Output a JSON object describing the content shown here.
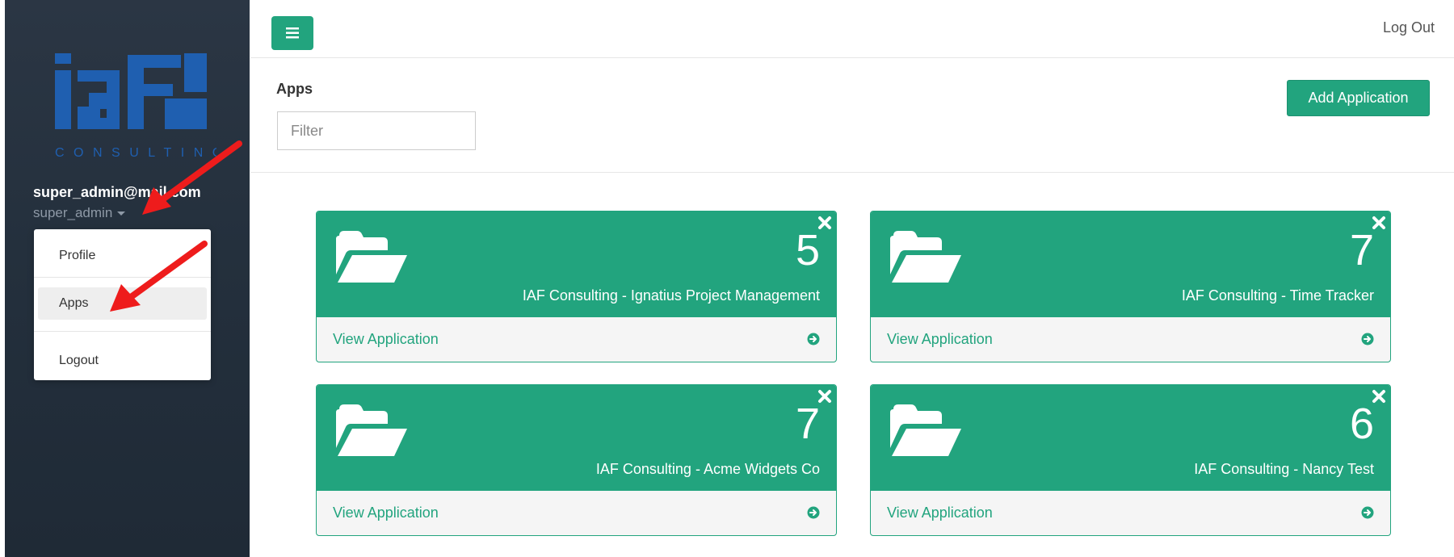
{
  "sidebar": {
    "logo_text": "iaF",
    "logo_subtext": "CONSULTING",
    "user_email": "super_admin@mail.com",
    "user_role": "super_admin",
    "menu": {
      "profile": "Profile",
      "apps": "Apps",
      "logout": "Logout"
    }
  },
  "topbar": {
    "menu_icon": "hamburger-icon",
    "logout_label": "Log Out"
  },
  "apps_header": {
    "title": "Apps",
    "filter_placeholder": "Filter",
    "add_label": "Add Application"
  },
  "cards": [
    {
      "count": "5",
      "name": "IAF Consulting - Ignatius Project Management",
      "view_label": "View Application"
    },
    {
      "count": "7",
      "name": "IAF Consulting - Time Tracker",
      "view_label": "View Application"
    },
    {
      "count": "7",
      "name": "IAF Consulting - Acme Widgets Co",
      "view_label": "View Application"
    },
    {
      "count": "6",
      "name": "IAF Consulting - Nancy Test",
      "view_label": "View Application"
    }
  ],
  "colors": {
    "accent": "#22a47e",
    "sidebar": "#26313e",
    "logo_blue": "#1f5fb0",
    "annotation_arrow": "#ee1c1c"
  }
}
